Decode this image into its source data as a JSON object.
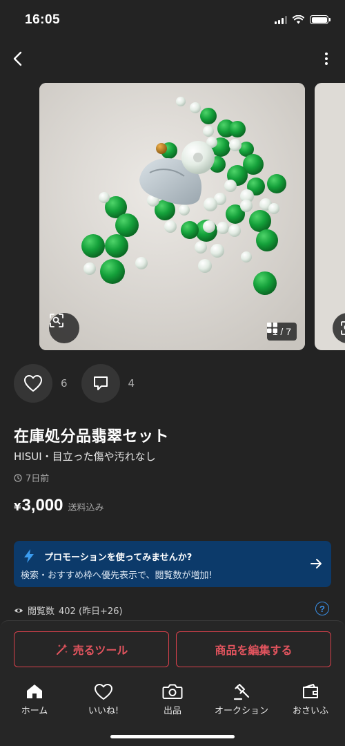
{
  "status_bar": {
    "time": "16:05"
  },
  "gallery": {
    "counter": "1 / 7"
  },
  "actions": {
    "likes": "6",
    "comments": "4"
  },
  "item": {
    "title": "在庫処分品翡翠セット",
    "subtitle": "HISUI・目立った傷や汚れなし",
    "posted": "7日前",
    "price_symbol": "¥",
    "price": "3,000",
    "shipping": "送料込み"
  },
  "promo": {
    "title": "プロモーションを使ってみませんか?",
    "description": "検索・おすすめ枠へ優先表示で、閲覧数が増加!"
  },
  "views": {
    "label": "閲覧数",
    "value": "402 (昨日+26)"
  },
  "buttons": {
    "sell_tools": "売るツール",
    "edit_item": "商品を編集する"
  },
  "tab_bar": {
    "home": "ホーム",
    "likes": "いいね!",
    "listing": "出品",
    "auction": "オークション",
    "wallet": "おさいふ"
  },
  "colors": {
    "background": "#232323",
    "accent_red": "#e2545e",
    "promo_blue": "#0c3a6a",
    "help_blue": "#3a8fe6"
  },
  "icons": [
    "back-arrow-icon",
    "more-vertical-icon",
    "image-search-icon",
    "grid-icon",
    "heart-icon",
    "comment-icon",
    "clock-icon",
    "lightning-icon",
    "arrow-right-icon",
    "eye-icon",
    "help-icon",
    "sparkle-wand-icon",
    "home-icon",
    "camera-icon",
    "gavel-icon",
    "wallet-icon"
  ]
}
